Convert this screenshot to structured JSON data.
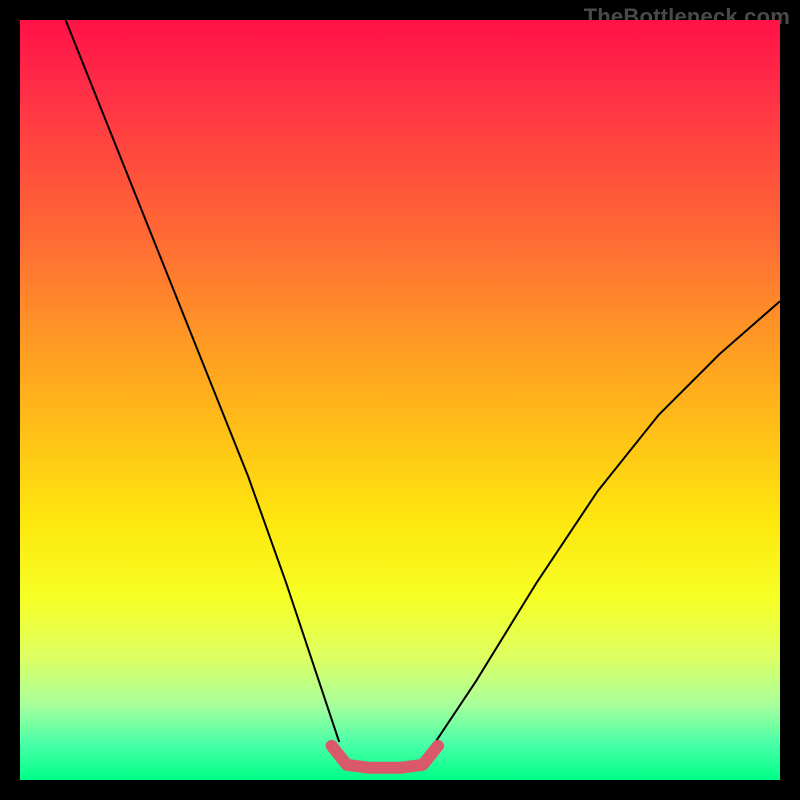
{
  "watermark": "TheBottleneck.com",
  "chart_data": {
    "type": "line",
    "title": "",
    "xlabel": "",
    "ylabel": "",
    "xlim": [
      0,
      100
    ],
    "ylim": [
      0,
      100
    ],
    "gradient_stops": [
      {
        "pos": 0,
        "color": "#ff1247"
      },
      {
        "pos": 8,
        "color": "#ff2a47"
      },
      {
        "pos": 18,
        "color": "#ff4a3e"
      },
      {
        "pos": 30,
        "color": "#ff6f33"
      },
      {
        "pos": 42,
        "color": "#ff9824"
      },
      {
        "pos": 54,
        "color": "#ffbf17"
      },
      {
        "pos": 66,
        "color": "#fde70e"
      },
      {
        "pos": 76,
        "color": "#f6ff25"
      },
      {
        "pos": 84,
        "color": "#dcff63"
      },
      {
        "pos": 90,
        "color": "#a8ff9a"
      },
      {
        "pos": 95,
        "color": "#4dffa9"
      },
      {
        "pos": 100,
        "color": "#00ff88"
      }
    ],
    "series": [
      {
        "name": "left-branch",
        "stroke": "#000000",
        "stroke_width": 2,
        "points": [
          {
            "x": 6,
            "y": 100
          },
          {
            "x": 12,
            "y": 85
          },
          {
            "x": 18,
            "y": 70
          },
          {
            "x": 24,
            "y": 55
          },
          {
            "x": 30,
            "y": 40
          },
          {
            "x": 35,
            "y": 26
          },
          {
            "x": 39,
            "y": 14
          },
          {
            "x": 42,
            "y": 5
          }
        ]
      },
      {
        "name": "right-branch",
        "stroke": "#000000",
        "stroke_width": 2,
        "points": [
          {
            "x": 54,
            "y": 4
          },
          {
            "x": 60,
            "y": 13
          },
          {
            "x": 68,
            "y": 26
          },
          {
            "x": 76,
            "y": 38
          },
          {
            "x": 84,
            "y": 48
          },
          {
            "x": 92,
            "y": 56
          },
          {
            "x": 100,
            "y": 63
          }
        ]
      },
      {
        "name": "bottom-highlight",
        "stroke": "#d9596a",
        "stroke_width": 12,
        "linecap": "round",
        "points": [
          {
            "x": 41,
            "y": 4.5
          },
          {
            "x": 43,
            "y": 2.0
          },
          {
            "x": 46,
            "y": 1.6
          },
          {
            "x": 50,
            "y": 1.6
          },
          {
            "x": 53,
            "y": 2.0
          },
          {
            "x": 55,
            "y": 4.5
          }
        ]
      }
    ]
  }
}
